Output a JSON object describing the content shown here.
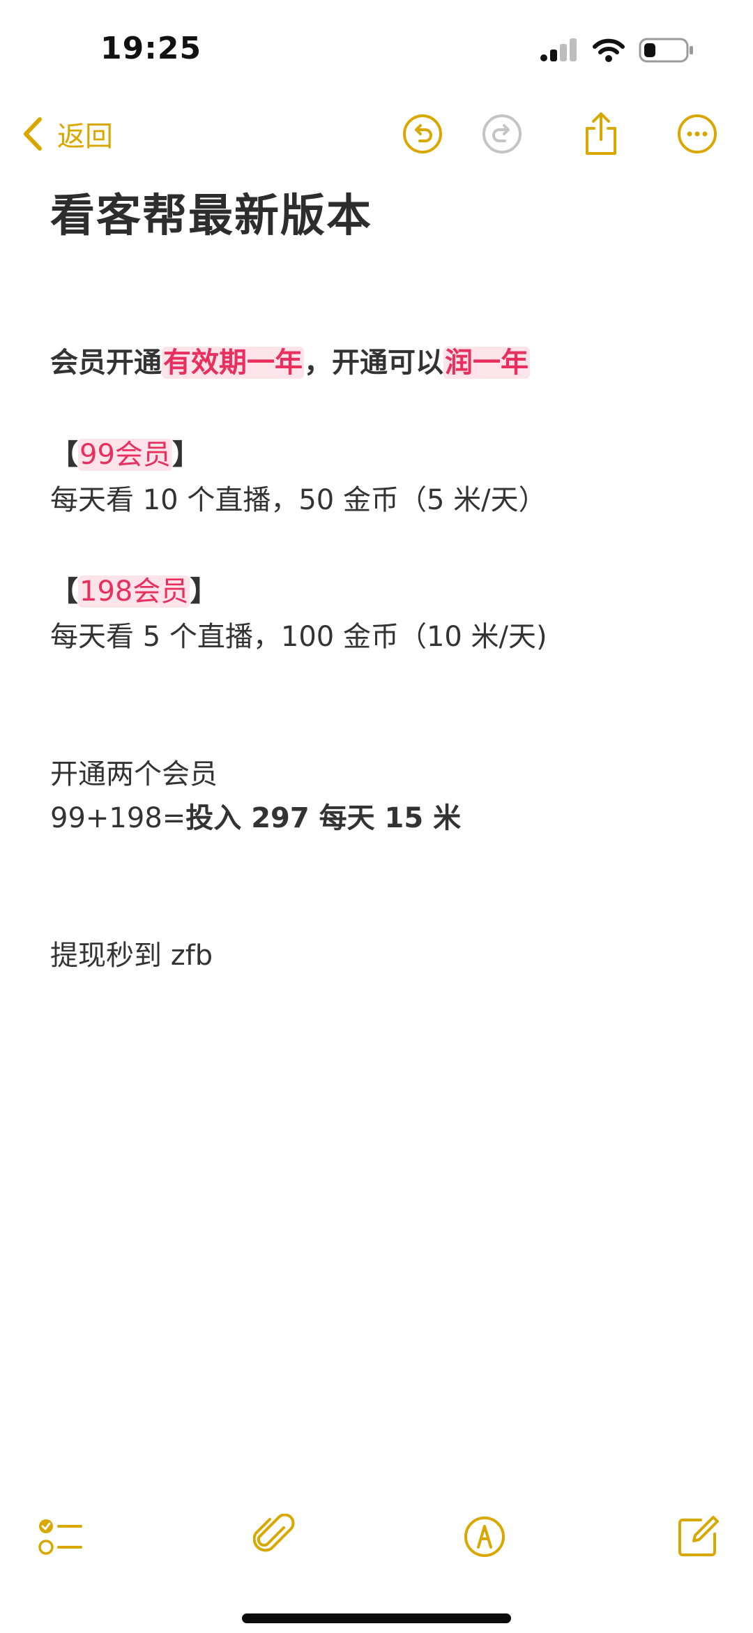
{
  "status_bar": {
    "time": "19:25"
  },
  "nav": {
    "back_label": "返回",
    "accent_color": "#d9a800",
    "disabled_color": "#c4c4c4"
  },
  "note": {
    "title": "看客帮最新版本",
    "line1": {
      "a": "会员开通",
      "b": "有效期一年",
      "c": "，开通可以",
      "d": "润一年"
    },
    "tier1": {
      "open": "【",
      "name": "99会员",
      "close": "】",
      "desc": "每天看 10 个直播，50 金币（5 米/天）"
    },
    "tier2": {
      "open": "【",
      "name": "198会员",
      "close": "】",
      "desc": "每天看 5 个直播，100 金币（10 米/天)"
    },
    "combo": {
      "line1": "开通两个会员",
      "line2_a": "99+198=",
      "line2_b": "投入 297 每天 15 米"
    },
    "withdraw": "提现秒到 zfb",
    "highlight_color": "#e8305f",
    "highlight_bg": "#fde3ea"
  },
  "icons": {
    "back": "chevron-left-icon",
    "undo": "undo-icon",
    "redo": "redo-icon",
    "share": "share-icon",
    "more": "more-icon",
    "checklist": "checklist-icon",
    "attach": "paperclip-icon",
    "markup": "markup-pen-icon",
    "compose": "compose-icon"
  }
}
